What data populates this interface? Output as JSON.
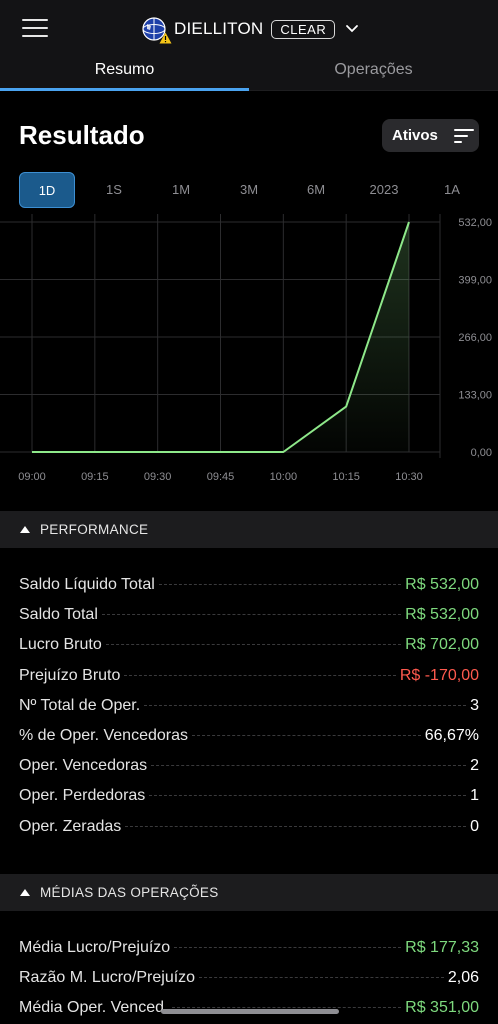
{
  "header": {
    "account_name": "DIELLITON",
    "broker": "CLEAR",
    "menu_icon": "hamburger-icon",
    "avatar_icon": "globe-avatar-icon",
    "warning_icon": "warning-icon",
    "chevron_icon": "chevron-down-icon"
  },
  "tabs": [
    {
      "label": "Resumo",
      "active": true
    },
    {
      "label": "Operações",
      "active": false
    }
  ],
  "page_title": "Resultado",
  "filter_button": {
    "label": "Ativos",
    "icon": "filter-lines-icon"
  },
  "periods": [
    {
      "label": "1D",
      "active": true
    },
    {
      "label": "1S",
      "active": false
    },
    {
      "label": "1M",
      "active": false
    },
    {
      "label": "3M",
      "active": false
    },
    {
      "label": "6M",
      "active": false
    },
    {
      "label": "2023",
      "active": false
    },
    {
      "label": "1A",
      "active": false
    }
  ],
  "colors": {
    "accent": "#4aa3f0",
    "positive": "#7ed97e",
    "negative": "#ff5a4e",
    "line": "#8ee88a"
  },
  "chart_data": {
    "type": "line",
    "x": [
      "09:00",
      "09:15",
      "09:30",
      "09:45",
      "10:00",
      "10:15",
      "10:30"
    ],
    "series": [
      {
        "values": [
          0,
          0,
          0,
          0,
          0,
          105,
          532
        ]
      }
    ],
    "y_ticks": [
      "532,00",
      "399,00",
      "266,00",
      "133,00",
      "0,00"
    ],
    "y_tick_values": [
      532,
      399,
      266,
      133,
      0
    ],
    "ylim": [
      0,
      532
    ],
    "grid": true
  },
  "performance": {
    "title": "PERFORMANCE",
    "rows": [
      {
        "label": "Saldo Líquido Total",
        "value": "R$ 532,00",
        "tone": "pos"
      },
      {
        "label": "Saldo Total",
        "value": "R$ 532,00",
        "tone": "pos"
      },
      {
        "label": "Lucro Bruto",
        "value": "R$ 702,00",
        "tone": "pos"
      },
      {
        "label": "Prejuízo Bruto",
        "value": "R$ -170,00",
        "tone": "neg"
      },
      {
        "label": "Nº Total de Oper.",
        "value": "3",
        "tone": ""
      },
      {
        "label": " % de Oper. Vencedoras",
        "value": "66,67%",
        "tone": ""
      },
      {
        "label": "Oper. Vencedoras",
        "value": "2",
        "tone": ""
      },
      {
        "label": "Oper. Perdedoras",
        "value": "1",
        "tone": ""
      },
      {
        "label": "Oper. Zeradas",
        "value": "0",
        "tone": ""
      }
    ]
  },
  "medias": {
    "title": "MÉDIAS DAS OPERAÇÕES",
    "rows": [
      {
        "label": "Média Lucro/Prejuízo",
        "value": "R$ 177,33",
        "tone": "pos"
      },
      {
        "label": "Razão M. Lucro/Prejuízo",
        "value": "2,06",
        "tone": ""
      },
      {
        "label": "Média Oper. Venced.",
        "value": "R$ 351,00",
        "tone": "pos"
      }
    ]
  }
}
